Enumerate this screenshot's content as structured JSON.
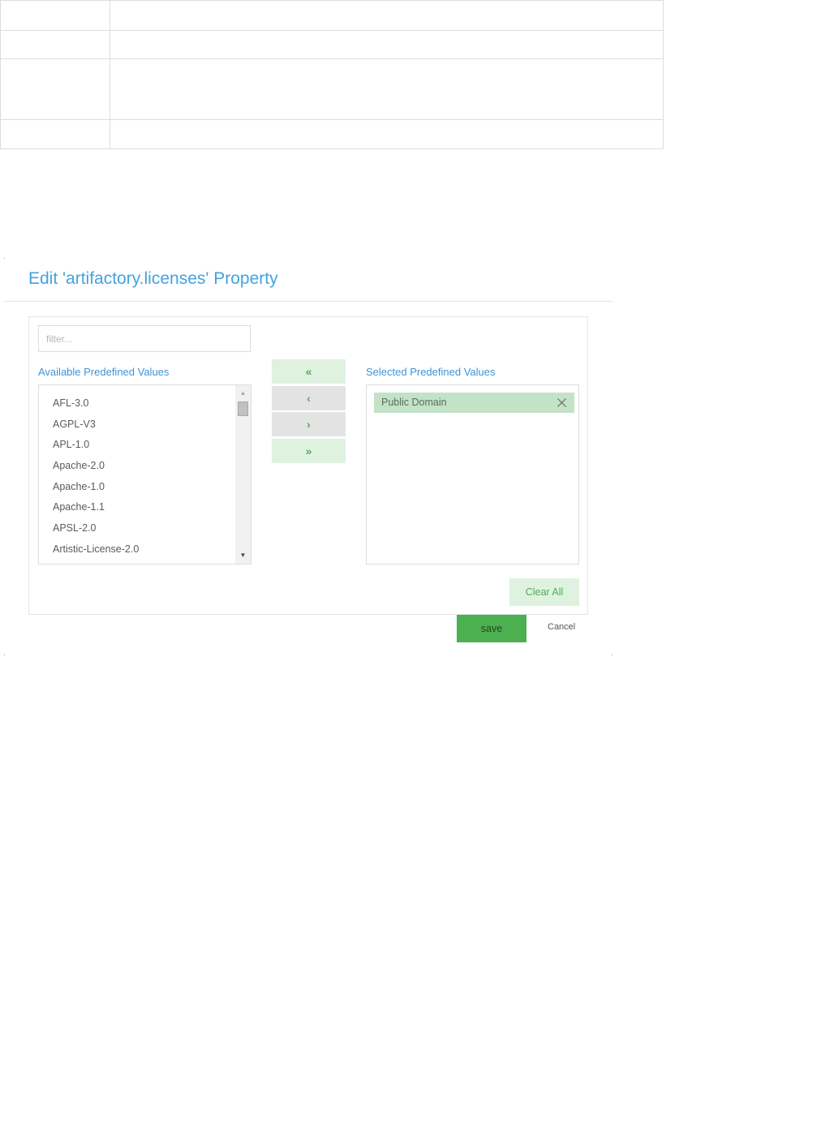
{
  "dialog": {
    "title": "Edit 'artifactory.licenses' Property"
  },
  "filter": {
    "placeholder": "filter..."
  },
  "available": {
    "label": "Available Predefined Values",
    "items": [
      "AFL-3.0",
      "AGPL-V3",
      "APL-1.0",
      "Apache-2.0",
      "Apache-1.0",
      "Apache-1.1",
      "APSL-2.0",
      "Artistic-License-2.0"
    ]
  },
  "selected": {
    "label": "Selected Predefined Values",
    "items": [
      "Public Domain"
    ]
  },
  "move_buttons": {
    "move_all_left": "«",
    "move_left": "‹",
    "move_right": "›",
    "move_all_right": "»"
  },
  "actions": {
    "clear_all": "Clear All",
    "save": "save",
    "cancel": "Cancel"
  },
  "colors": {
    "title": "#43a3e0",
    "label": "#3d94d4",
    "accent_green": "#4caf50",
    "light_green": "#dff2e0",
    "selected_item_bg": "#c3e3c6"
  },
  "icons": {
    "remove": "close-icon",
    "scroll_up": "arrow-up-icon",
    "scroll_down": "arrow-down-icon"
  }
}
